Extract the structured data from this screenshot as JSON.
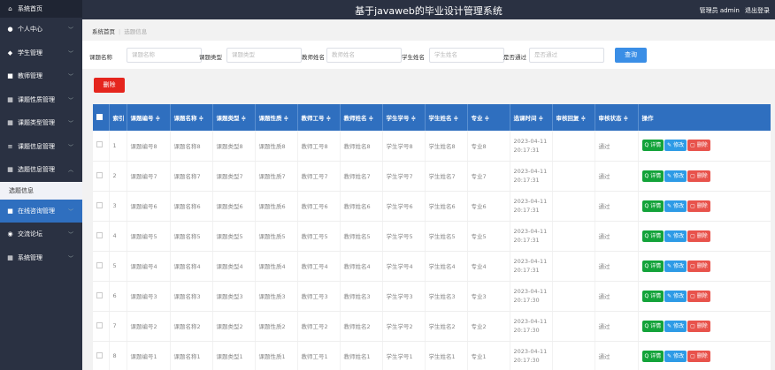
{
  "app_title": "基于javaweb的毕业设计管理系统",
  "user_text": "管理员 admin",
  "logout": "退出登录",
  "sidebar": {
    "items": [
      {
        "label": "系统首页",
        "icon": "home-icon",
        "chevron": false
      },
      {
        "label": "个人中心",
        "icon": "user-icon",
        "chevron": true
      },
      {
        "label": "学生管理",
        "icon": "student-icon",
        "chevron": true
      },
      {
        "label": "教师管理",
        "icon": "teacher-icon",
        "chevron": true
      },
      {
        "label": "课题性质管理",
        "icon": "grid-icon",
        "chevron": true
      },
      {
        "label": "课题类型管理",
        "icon": "grid-icon",
        "chevron": true
      },
      {
        "label": "课题信息管理",
        "icon": "list-icon",
        "chevron": true
      },
      {
        "label": "选题信息管理",
        "icon": "grid-icon",
        "chevron": true,
        "expanded": true
      }
    ],
    "sub_item": "选题信息",
    "items2": [
      {
        "label": "在线咨询管理",
        "icon": "chat-icon",
        "chevron": true,
        "active": true
      },
      {
        "label": "交流论坛",
        "icon": "forum-icon",
        "chevron": true
      },
      {
        "label": "系统管理",
        "icon": "grid-icon",
        "chevron": true
      }
    ]
  },
  "breadcrumb": {
    "home": "系统首页",
    "current": "选题信息"
  },
  "filters": [
    {
      "label": "课题名称",
      "placeholder": "课题名称"
    },
    {
      "label": "课题类型",
      "placeholder": "课题类型"
    },
    {
      "label": "教师姓名",
      "placeholder": "教师姓名"
    },
    {
      "label": "学生姓名",
      "placeholder": "学生姓名"
    },
    {
      "label": "是否通过",
      "placeholder": "是否通过",
      "select": true
    }
  ],
  "search_label": "查询",
  "delete_label": "删除",
  "table": {
    "headers": [
      "索引",
      "课题编号 ≑",
      "课题名称 ≑",
      "课题类型 ≑",
      "课题性质 ≑",
      "教师工号 ≑",
      "教师姓名 ≑",
      "学生学号 ≑",
      "学生姓名 ≑",
      "专业 ≑",
      "选课时间 ≑",
      "审核回复 ≑",
      "审核状态 ≑",
      "操作"
    ],
    "rows": [
      [
        "1",
        "课题编号8",
        "课题名称8",
        "课题类型8",
        "课题性质8",
        "教师工号8",
        "教师姓名8",
        "学生学号8",
        "学生姓名8",
        "专业8",
        "2023-04-11 20:17:31",
        "",
        "通过"
      ],
      [
        "2",
        "课题编号7",
        "课题名称7",
        "课题类型7",
        "课题性质7",
        "教师工号7",
        "教师姓名7",
        "学生学号7",
        "学生姓名7",
        "专业7",
        "2023-04-11 20:17:31",
        "",
        "通过"
      ],
      [
        "3",
        "课题编号6",
        "课题名称6",
        "课题类型6",
        "课题性质6",
        "教师工号6",
        "教师姓名6",
        "学生学号6",
        "学生姓名6",
        "专业6",
        "2023-04-11 20:17:31",
        "",
        "通过"
      ],
      [
        "4",
        "课题编号5",
        "课题名称5",
        "课题类型5",
        "课题性质5",
        "教师工号5",
        "教师姓名5",
        "学生学号5",
        "学生姓名5",
        "专业5",
        "2023-04-11 20:17:31",
        "",
        "通过"
      ],
      [
        "5",
        "课题编号4",
        "课题名称4",
        "课题类型4",
        "课题性质4",
        "教师工号4",
        "教师姓名4",
        "学生学号4",
        "学生姓名4",
        "专业4",
        "2023-04-11 20:17:31",
        "",
        "通过"
      ],
      [
        "6",
        "课题编号3",
        "课题名称3",
        "课题类型3",
        "课题性质3",
        "教师工号3",
        "教师姓名3",
        "学生学号3",
        "学生姓名3",
        "专业3",
        "2023-04-11 20:17:30",
        "",
        "通过"
      ],
      [
        "7",
        "课题编号2",
        "课题名称2",
        "课题类型2",
        "课题性质2",
        "教师工号2",
        "教师姓名2",
        "学生学号2",
        "学生姓名2",
        "专业2",
        "2023-04-11 20:17:30",
        "",
        "通过"
      ],
      [
        "8",
        "课题编号1",
        "课题名称1",
        "课题类型1",
        "课题性质1",
        "教师工号1",
        "教师姓名1",
        "学生学号1",
        "学生姓名1",
        "专业1",
        "2023-04-11 20:17:30",
        "",
        "通过"
      ]
    ],
    "actions": {
      "detail": "详情",
      "edit": "修改",
      "delete": "删除"
    }
  },
  "colors": {
    "header_bg": "#2a3142",
    "accent": "#2f6fbf",
    "danger": "#e5251d",
    "success": "#13a33a"
  }
}
